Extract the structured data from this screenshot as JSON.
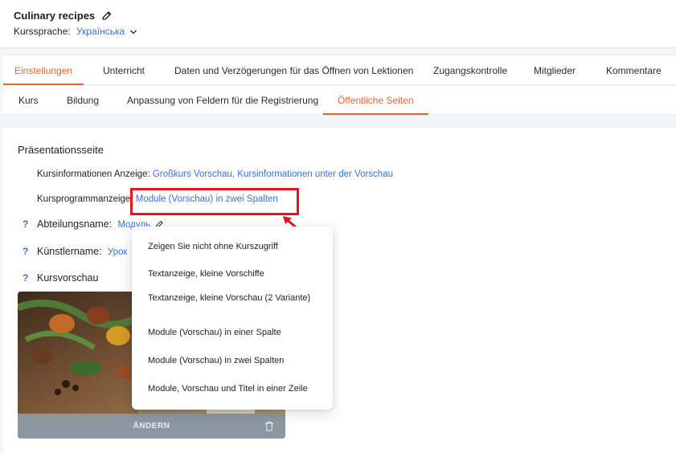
{
  "header": {
    "course_title": "Culinary recipes",
    "language_label": "Kurssprache:",
    "language_value": "Українська"
  },
  "main_tabs": [
    {
      "label": "Einstellungen",
      "active": true
    },
    {
      "label": "Unterricht",
      "active": false
    },
    {
      "label": "Daten und Verzögerungen für das Öffnen von Lektionen",
      "active": false
    },
    {
      "label": "Zugangskontrolle",
      "active": false
    },
    {
      "label": "Mitglieder",
      "active": false
    },
    {
      "label": "Kommentare",
      "active": false
    }
  ],
  "sub_tabs": [
    {
      "label": "Kurs",
      "active": false
    },
    {
      "label": "Bildung",
      "active": false
    },
    {
      "label": "Anpassung von Feldern für die Registrierung",
      "active": false
    },
    {
      "label": "Öffentliche Seiten",
      "active": true
    }
  ],
  "section": {
    "title": "Präsentationsseite",
    "course_info_label": "Kursinformationen Anzeige:",
    "course_info_value": "Großkurs Vorschau, Kursinformationen unter der Vorschau",
    "program_label": "Kursprogrammanzeige:",
    "program_value": "Module (Vorschau) in zwei Spalten",
    "department_help": "?",
    "department_label": "Abteilungsname:",
    "department_value": "Модуль",
    "artist_help": "?",
    "artist_label": "Künstlername:",
    "artist_value": "Урок",
    "preview_help": "?",
    "preview_label": "Kursvorschau",
    "change_label": "ÄNDERN"
  },
  "dropdown": {
    "options": [
      "Zeigen Sie nicht ohne Kurszugriff",
      "Textanzeige, kleine Vorschiffe",
      "Textanzeige, kleine Vorschau (2 Variante)",
      "Module (Vorschau) in einer Spalte",
      "Module (Vorschau) in zwei Spalten",
      "Module, Vorschau und Titel in einer Zeile"
    ]
  },
  "colors": {
    "accent": "#e8642c",
    "link": "#3b6fd6",
    "highlight": "#e3161d"
  }
}
